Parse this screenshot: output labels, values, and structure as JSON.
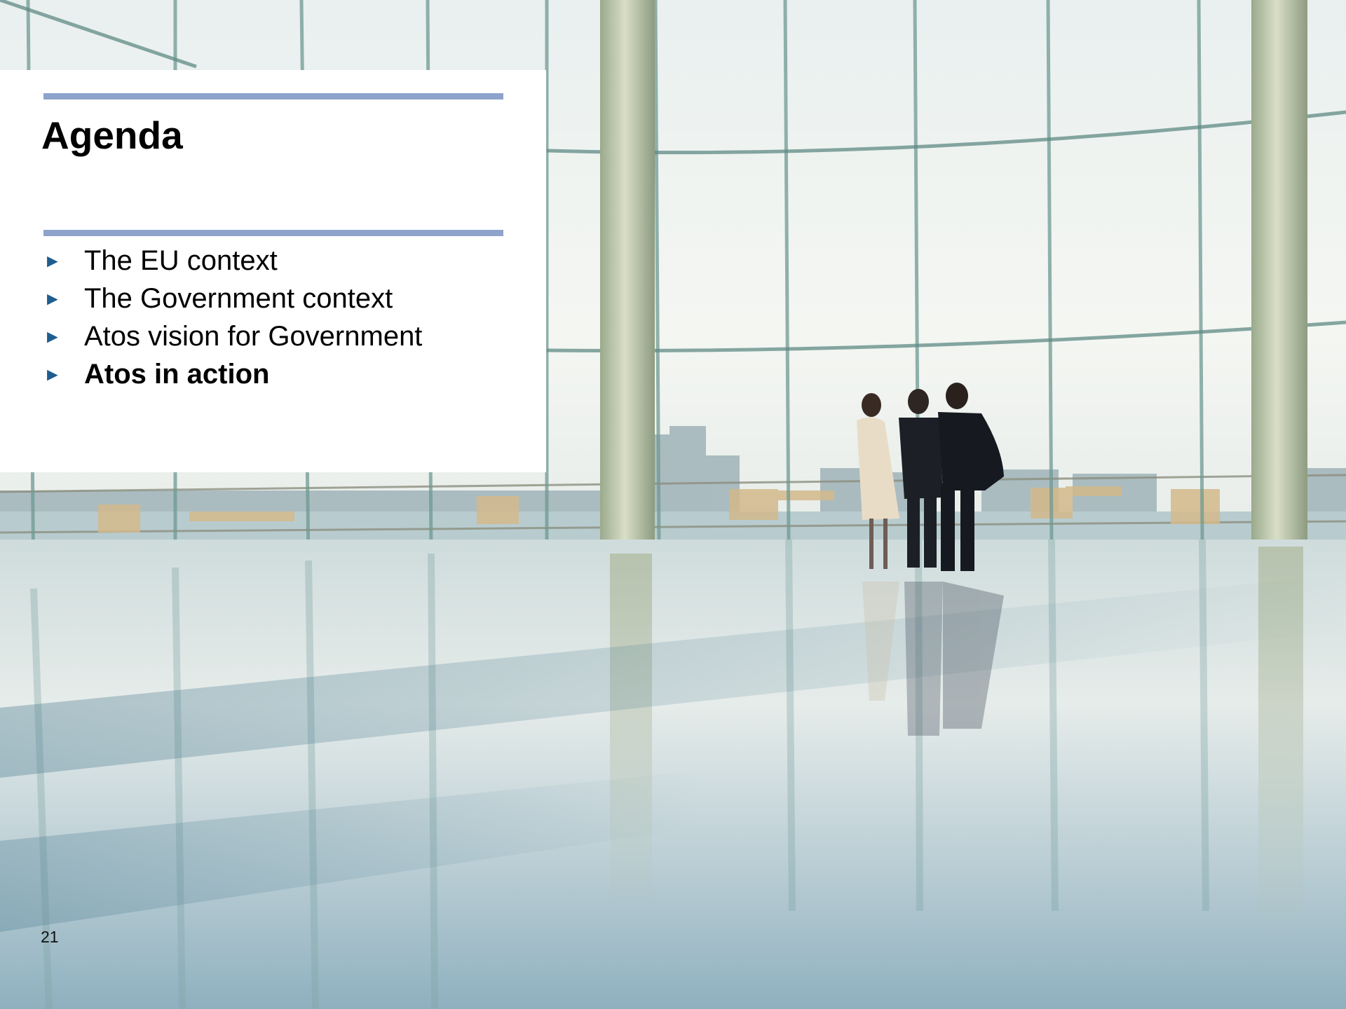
{
  "slide": {
    "title": "Agenda",
    "page_number": "21",
    "accent_color": "#8ea3cc",
    "bullet_color": "#1f5d8f",
    "bullet_icon": "right-triangle-bullet",
    "agenda_items": [
      {
        "label": "The EU context",
        "active": false
      },
      {
        "label": "The Government context",
        "active": false
      },
      {
        "label": "Atos vision for Government",
        "active": false
      },
      {
        "label": "Atos in action",
        "active": true
      }
    ]
  }
}
